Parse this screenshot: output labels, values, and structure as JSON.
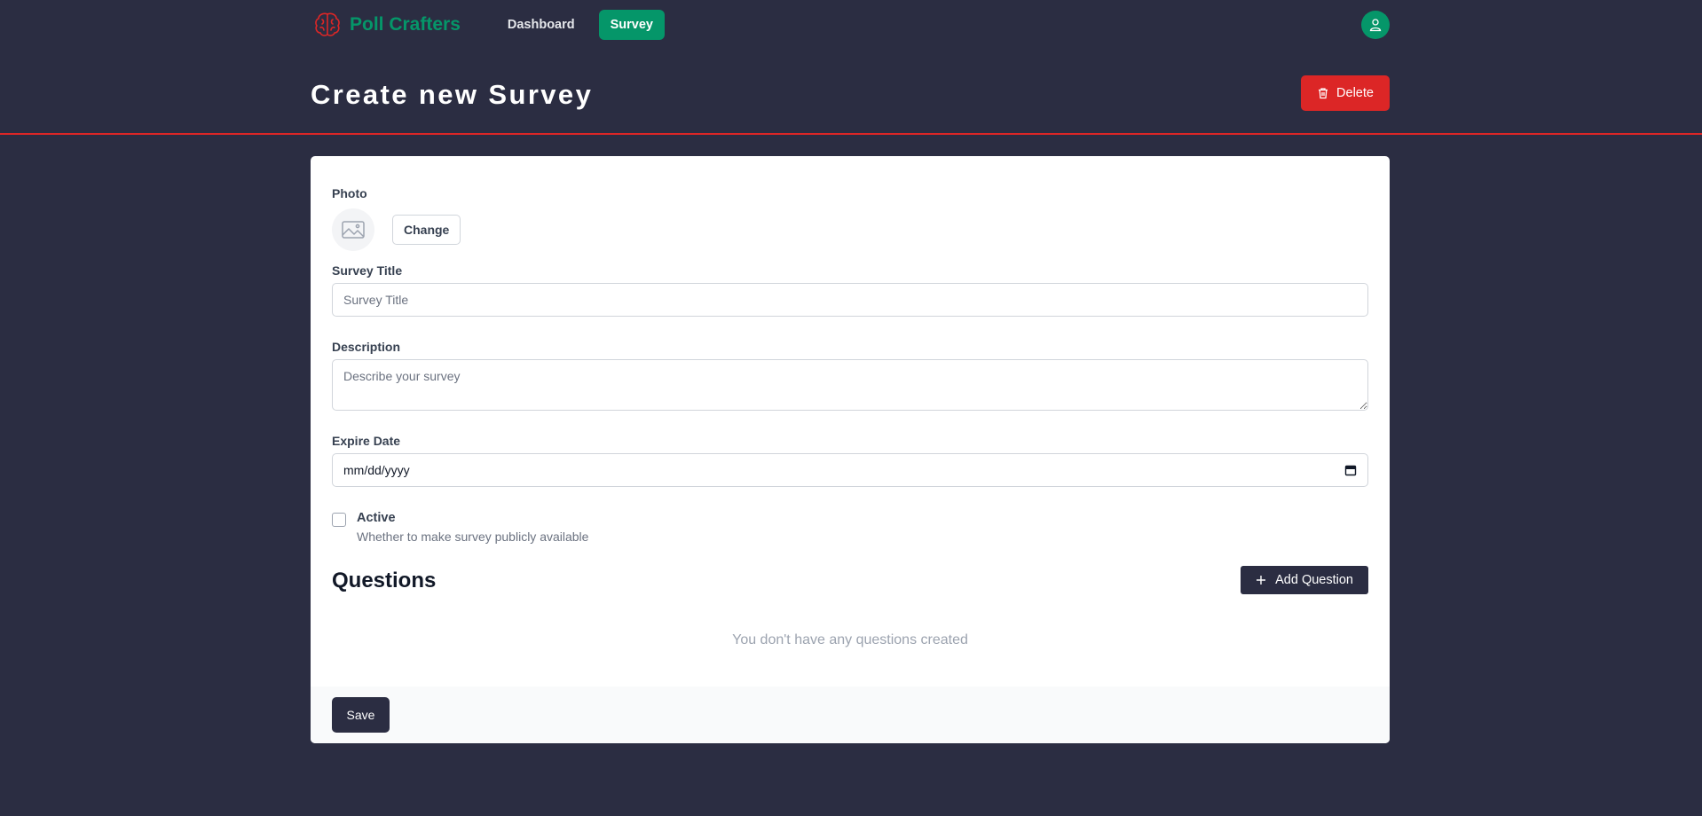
{
  "nav": {
    "brand": "Poll Crafters",
    "links": [
      {
        "label": "Dashboard",
        "active": false
      },
      {
        "label": "Survey",
        "active": true
      }
    ],
    "avatar_icon": "user-icon"
  },
  "header": {
    "title": "Create new Survey",
    "delete_label": "Delete"
  },
  "form": {
    "photo_label": "Photo",
    "change_label": "Change",
    "title_label": "Survey Title",
    "title_placeholder": "Survey Title",
    "description_label": "Description",
    "description_placeholder": "Describe your survey",
    "expire_label": "Expire Date",
    "expire_value": "mm/dd/yyyy",
    "active_label": "Active",
    "active_help": "Whether to make survey publicly available",
    "active_checked": false
  },
  "questions": {
    "title": "Questions",
    "add_label": "Add Question",
    "empty_message": "You don't have any questions created"
  },
  "footer": {
    "save_label": "Save"
  },
  "colors": {
    "background": "#2b2d42",
    "brand": "#059669",
    "danger": "#dc2626"
  }
}
